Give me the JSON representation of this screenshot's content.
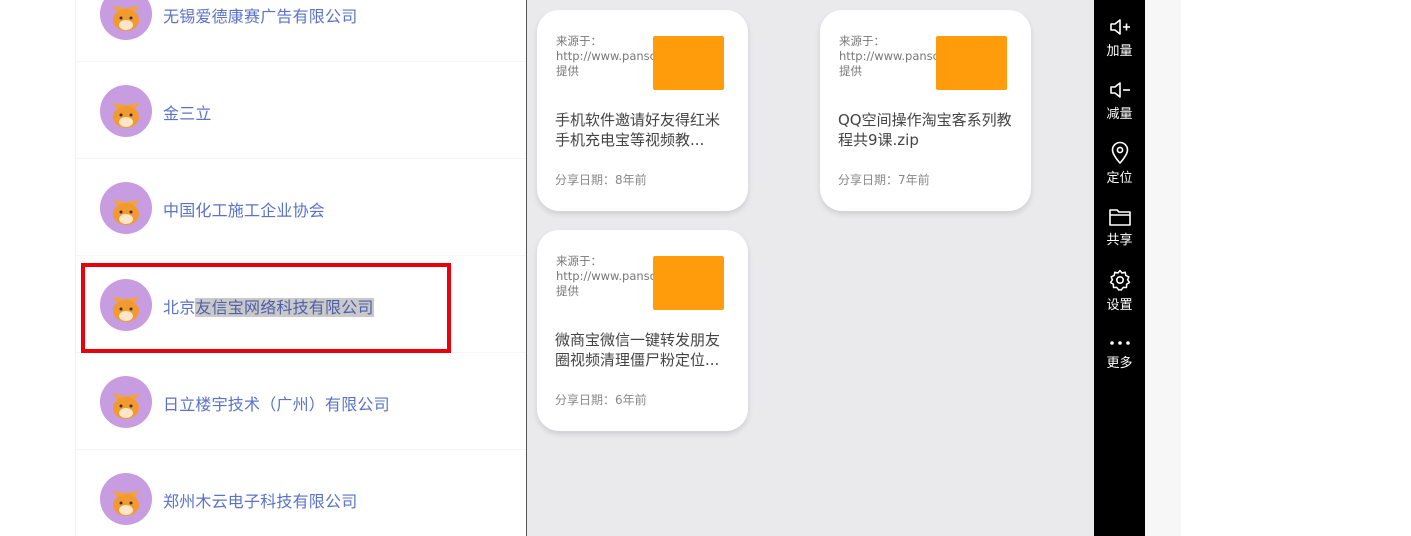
{
  "companies": [
    {
      "name": "无锡爱德康赛广告有限公司"
    },
    {
      "name": "金三立"
    },
    {
      "name": "中国化工施工企业协会"
    },
    {
      "name_plain": "北京",
      "name_highlighted": "友信宝网络科技有限公司"
    },
    {
      "name": "日立楼宇技术（广州）有限公司"
    },
    {
      "name": "郑州木云电子科技有限公司"
    }
  ],
  "cards": [
    {
      "source": "来源于：http://www.pansoso.org提供",
      "title": "手机软件邀请好友得红米手机充电宝等视频教...",
      "date": "分享日期：8年前"
    },
    {
      "source": "来源于：http://www.pansoso.org提供",
      "title": "QQ空间操作淘宝客系列教程共9课.zip",
      "date": "分享日期：7年前"
    },
    {
      "source": "来源于：http://www.pansoso.org提供",
      "title": "微商宝微信一键转发朋友圈视频清理僵尸粉定位...",
      "date": "分享日期：6年前"
    }
  ],
  "toolbar": {
    "volume_up": "加量",
    "volume_down": "减量",
    "locate": "定位",
    "share": "共享",
    "settings": "设置",
    "more": "更多"
  },
  "colors": {
    "accent_text": "#5a73c8",
    "highlight_box": "#e8000b",
    "thumb": "#ff9c0b"
  }
}
